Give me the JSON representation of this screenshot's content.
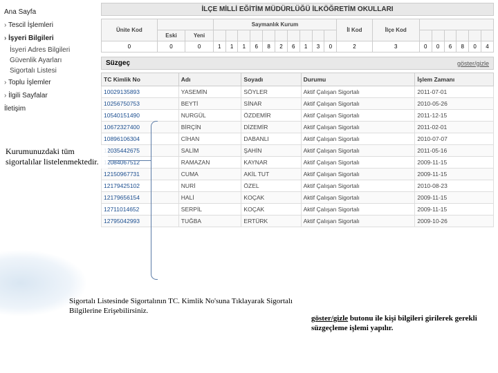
{
  "sidebar": {
    "home": "Ana Sayfa",
    "sections": [
      {
        "label": "Tescil İşlemleri",
        "bold": false
      },
      {
        "label": "İşyeri Bilgileri",
        "bold": true
      }
    ],
    "subitems": [
      "İsyeri Adres Bilgileri",
      "Güvenlik Ayarları",
      "Sigortalı Listesi"
    ],
    "more_sections": [
      "Toplu İşlemler",
      "İlgili Sayfalar",
      "İletişim"
    ]
  },
  "page_title": "İLÇE MİLLİ EĞİTİM MÜDÜRLÜĞÜ İLKÖĞRETİM OKULLARI",
  "header_table": {
    "columns": [
      "Ünite Kod",
      "",
      "",
      "",
      "",
      "Saymanlık Kurum",
      "",
      "",
      "",
      "",
      "",
      "",
      "",
      "İl Kod",
      "İlçe Kod",
      "",
      ""
    ],
    "sub": {
      "eski": "Eski",
      "yeni": "Yeni"
    },
    "row": [
      "0",
      "0",
      "0",
      "1",
      "1",
      "1",
      "6",
      "8",
      "2",
      "6",
      "1",
      "3",
      "0",
      "2",
      "3",
      "0",
      "0",
      "6",
      "8",
      "0",
      "4"
    ]
  },
  "filter": {
    "label": "Süzgeç",
    "toggle": "göster/gizle"
  },
  "table": {
    "columns": [
      "TC Kimlik No",
      "Adı",
      "Soyadı",
      "Durumu",
      "İşlem Zamanı"
    ],
    "rows": [
      [
        "10029135893",
        "YASEMİN",
        "SÖYLER",
        "Aktif Çalışan Sigortalı",
        "2011-07-01"
      ],
      [
        "10256750753",
        "BEYTİ",
        "SİNAR",
        "Aktif Çalışan Sigortalı",
        "2010-05-26"
      ],
      [
        "10540151490",
        "NURGÜL",
        "ÖZDEMİR",
        "Aktif Çalışan Sigortalı",
        "2011-12-15"
      ],
      [
        "10672327400",
        "BİRÇİN",
        "DİZEMİR",
        "Aktif Çalışan Sigortalı",
        "2011-02-01"
      ],
      [
        "10896106304",
        "CİHAN",
        "DABANLI",
        "Aktif Çalışan Sigortalı",
        "2010-07-07"
      ],
      [
        "12035442675",
        "SALİM",
        "ŞAHİN",
        "Aktif Çalışan Sigortalı",
        "2011-05-16"
      ],
      [
        "12084067512",
        "RAMAZAN",
        "KAYNAR",
        "Aktif Çalışan Sigortalı",
        "2009-11-15"
      ],
      [
        "12150967731",
        "CUMA",
        "AKİL TUT",
        "Aktif Çalışan Sigortalı",
        "2009-11-15"
      ],
      [
        "12179425102",
        "NURİ",
        "ÖZEL",
        "Aktif Çalışan Sigortalı",
        "2010-08-23"
      ],
      [
        "12179656154",
        "HALİ",
        "KOÇAK",
        "Aktif Çalışan Sigortalı",
        "2009-11-15"
      ],
      [
        "12711014652",
        "SERPİL",
        "KOÇAK",
        "Aktif Çalışan Sigortalı",
        "2009-11-15"
      ],
      [
        "12795042993",
        "TUĞBA",
        "ERTÜRK",
        "Aktif Çalışan Sigortalı",
        "2009-10-26"
      ]
    ]
  },
  "callouts": {
    "left": "Kurumunuzdaki tüm sigortalılar listelenmektedir.",
    "bottom": "Sigortalı Listesinde Sigortalının TC. Kimlik No'suna Tıklayarak Sigortalı Bilgilerine Erişebilirsiniz.",
    "right_bold_underline": "göster/gizle",
    "right_bold": " butonu ile kişi bilgileri girilerek gerekli süzgeçleme işlemi yapılır."
  }
}
